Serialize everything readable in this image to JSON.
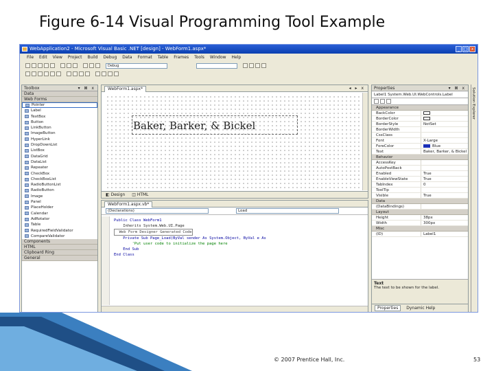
{
  "slide": {
    "title": "Figure 6-14 Visual Programming Tool Example",
    "footer": "© 2007 Prentice Hall, Inc.",
    "page_number": "53"
  },
  "window": {
    "title": "WebApplication2 - Microsoft Visual Basic .NET [design] - WebForm1.aspx*",
    "controls": [
      "_",
      "□",
      "x"
    ]
  },
  "menu": [
    "File",
    "Edit",
    "View",
    "Project",
    "Build",
    "Debug",
    "Data",
    "Format",
    "Table",
    "Frames",
    "Tools",
    "Window",
    "Help"
  ],
  "toolbar": {
    "config_value": "Debug"
  },
  "toolbox": {
    "title": "Toolbox",
    "sections_top": [
      "Data",
      "Web Forms"
    ],
    "items": [
      "Pointer",
      "Label",
      "TextBox",
      "Button",
      "LinkButton",
      "ImageButton",
      "HyperLink",
      "DropDownList",
      "ListBox",
      "DataGrid",
      "DataList",
      "Repeater",
      "CheckBox",
      "CheckBoxList",
      "RadioButtonList",
      "RadioButton",
      "Image",
      "Panel",
      "PlaceHolder",
      "Calendar",
      "AdRotator",
      "Table",
      "RequiredFieldValidator",
      "CompareValidator"
    ],
    "sections_bottom": [
      "Components",
      "HTML",
      "Clipboard Ring",
      "General"
    ]
  },
  "designer": {
    "tab": "WebForm1.aspx*",
    "label_text": "Baker, Barker, & Bickel",
    "view_tabs": [
      "Design",
      "HTML"
    ]
  },
  "code_editor": {
    "tab": "WebForm1.aspx.vb*",
    "class_combo": "(Declarations)",
    "method_combo": "Load",
    "lines": [
      "Public Class WebForm1",
      "    Inherits System.Web.UI.Page",
      "",
      "  Web Form Designer Generated Code",
      "",
      "    Private Sub Page_Load(ByVal sender As System.Object, ByVal e As",
      "        'Put user code to initialize the page here",
      "    End Sub",
      "",
      "End Class"
    ]
  },
  "properties": {
    "title": "Properties",
    "object": "Label1  System.Web.UI.WebControls.Label",
    "rows": [
      {
        "type": "cat",
        "k": "Appearance"
      },
      {
        "k": "BackColor",
        "v": ""
      },
      {
        "k": "BorderColor",
        "v": ""
      },
      {
        "k": "BorderStyle",
        "v": "NotSet"
      },
      {
        "k": "BorderWidth",
        "v": ""
      },
      {
        "k": "CssClass",
        "v": ""
      },
      {
        "k": "Font",
        "v": "X-Large"
      },
      {
        "k": "ForeColor",
        "v": "Blue"
      },
      {
        "k": "Text",
        "v": "Baker, Barker, & Bickel"
      },
      {
        "type": "cat",
        "k": "Behavior"
      },
      {
        "k": "AccessKey",
        "v": ""
      },
      {
        "k": "AutoPostBack",
        "v": ""
      },
      {
        "k": "Enabled",
        "v": "True"
      },
      {
        "k": "EnableViewState",
        "v": "True"
      },
      {
        "k": "TabIndex",
        "v": "0"
      },
      {
        "k": "ToolTip",
        "v": ""
      },
      {
        "k": "Visible",
        "v": "True"
      },
      {
        "type": "cat",
        "k": "Data"
      },
      {
        "k": "(DataBindings)",
        "v": ""
      },
      {
        "type": "cat",
        "k": "Layout"
      },
      {
        "k": "Height",
        "v": "38px"
      },
      {
        "k": "Width",
        "v": "300px"
      },
      {
        "type": "cat",
        "k": "Misc"
      },
      {
        "k": "(ID)",
        "v": "Label1"
      }
    ],
    "description_title": "Text",
    "description": "The text to be shown for the label.",
    "bottom_tabs": [
      "Properties",
      "Dynamic Help"
    ]
  },
  "side_strip": "Solution Explorer",
  "colors": {
    "titlebar": "#0a3fb0",
    "chrome": "#ece9d8",
    "forecolor_swatch": "#1a2fb8",
    "deco_blue": "#2e6da4"
  }
}
